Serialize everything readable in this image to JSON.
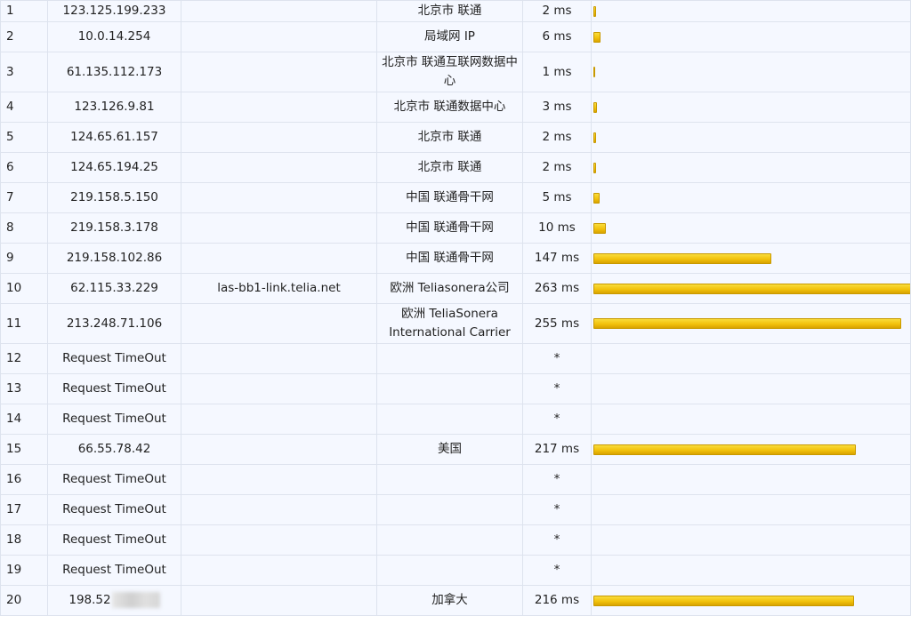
{
  "accent_bar_color": "#f2c20c",
  "max_ms_scale": 263,
  "rows": [
    {
      "hop": "1",
      "ip": "123.125.199.233",
      "host": "",
      "loc": "北京市 联通",
      "time": "2 ms",
      "ms": 2
    },
    {
      "hop": "2",
      "ip": "10.0.14.254",
      "host": "",
      "loc": "局域网 IP",
      "time": "6 ms",
      "ms": 6
    },
    {
      "hop": "3",
      "ip": "61.135.112.173",
      "host": "",
      "loc": "北京市 联通互联网数据中心",
      "time": "1 ms",
      "ms": 1
    },
    {
      "hop": "4",
      "ip": "123.126.9.81",
      "host": "",
      "loc": "北京市 联通数据中心",
      "time": "3 ms",
      "ms": 3
    },
    {
      "hop": "5",
      "ip": "124.65.61.157",
      "host": "",
      "loc": "北京市 联通",
      "time": "2 ms",
      "ms": 2
    },
    {
      "hop": "6",
      "ip": "124.65.194.25",
      "host": "",
      "loc": "北京市 联通",
      "time": "2 ms",
      "ms": 2
    },
    {
      "hop": "7",
      "ip": "219.158.5.150",
      "host": "",
      "loc": "中国 联通骨干网",
      "time": "5 ms",
      "ms": 5
    },
    {
      "hop": "8",
      "ip": "219.158.3.178",
      "host": "",
      "loc": "中国 联通骨干网",
      "time": "10 ms",
      "ms": 10
    },
    {
      "hop": "9",
      "ip": "219.158.102.86",
      "host": "",
      "loc": "中国 联通骨干网",
      "time": "147 ms",
      "ms": 147
    },
    {
      "hop": "10",
      "ip": "62.115.33.229",
      "host": "las-bb1-link.telia.net",
      "loc": "欧洲 Teliasonera公司",
      "time": "263 ms",
      "ms": 263
    },
    {
      "hop": "11",
      "ip": "213.248.71.106",
      "host": "",
      "loc": "欧洲 TeliaSonera International Carrier",
      "time": "255 ms",
      "ms": 255
    },
    {
      "hop": "12",
      "ip": "Request TimeOut",
      "host": "",
      "loc": "",
      "time": "*",
      "ms": 0
    },
    {
      "hop": "13",
      "ip": "Request TimeOut",
      "host": "",
      "loc": "",
      "time": "*",
      "ms": 0
    },
    {
      "hop": "14",
      "ip": "Request TimeOut",
      "host": "",
      "loc": "",
      "time": "*",
      "ms": 0
    },
    {
      "hop": "15",
      "ip": "66.55.78.42",
      "host": "",
      "loc": "美国",
      "time": "217 ms",
      "ms": 217
    },
    {
      "hop": "16",
      "ip": "Request TimeOut",
      "host": "",
      "loc": "",
      "time": "*",
      "ms": 0
    },
    {
      "hop": "17",
      "ip": "Request TimeOut",
      "host": "",
      "loc": "",
      "time": "*",
      "ms": 0
    },
    {
      "hop": "18",
      "ip": "Request TimeOut",
      "host": "",
      "loc": "",
      "time": "*",
      "ms": 0
    },
    {
      "hop": "19",
      "ip": "Request TimeOut",
      "host": "",
      "loc": "",
      "time": "*",
      "ms": 0
    },
    {
      "hop": "20",
      "ip": "198.52",
      "ip_redacted": true,
      "host": "",
      "loc": "加拿大",
      "time": "216 ms",
      "ms": 216
    }
  ]
}
